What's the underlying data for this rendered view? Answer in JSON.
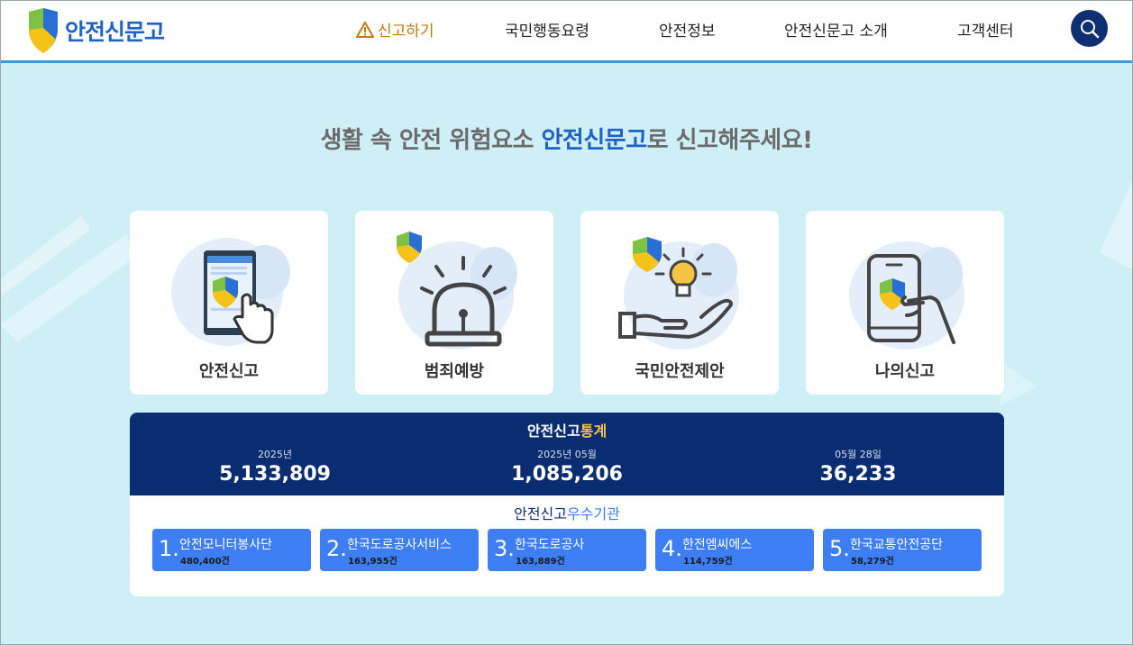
{
  "header": {
    "logo_text": "안전신문고",
    "nav": [
      {
        "label": "신고하기",
        "active": true
      },
      {
        "label": "국민행동요령"
      },
      {
        "label": "안전정보"
      },
      {
        "label": "안전신문고 소개"
      },
      {
        "label": "고객센터"
      }
    ],
    "search_icon": "search-icon"
  },
  "headline": {
    "before": "생활 속 안전 위험요소 ",
    "highlight": "안전신문고",
    "after": "로 신고해주세요!"
  },
  "cards": [
    {
      "label": "안전신고",
      "icon": "phone-touch-icon"
    },
    {
      "label": "범죄예방",
      "icon": "siren-icon"
    },
    {
      "label": "국민안전제안",
      "icon": "lightbulb-hand-icon"
    },
    {
      "label": "나의신고",
      "icon": "phone-hand-icon"
    }
  ],
  "stats": {
    "title_a": "안전신고",
    "title_b": "통계",
    "items": [
      {
        "label": "2025년",
        "value": "5,133,809"
      },
      {
        "label": "2025년 05월",
        "value": "1,085,206"
      },
      {
        "label": "05월 28일",
        "value": "36,233"
      }
    ],
    "org_title_a": "안전신고",
    "org_title_b": "우수기관",
    "orgs": [
      {
        "num": "1.",
        "name": "안전모니터봉사단",
        "count": "480,400건"
      },
      {
        "num": "2.",
        "name": "한국도로공사서비스",
        "count": "163,955건"
      },
      {
        "num": "3.",
        "name": "한국도로공사",
        "count": "163,889건"
      },
      {
        "num": "4.",
        "name": "한전엠씨에스",
        "count": "114,759건"
      },
      {
        "num": "5.",
        "name": "한국교통안전공단",
        "count": "58,279건"
      }
    ]
  },
  "colors": {
    "brand_blue": "#1d62c4",
    "navy": "#0a2d72",
    "active_nav": "#c47a0e",
    "page_bg": "#cfeff6",
    "org_blue": "#3d7ef5"
  }
}
